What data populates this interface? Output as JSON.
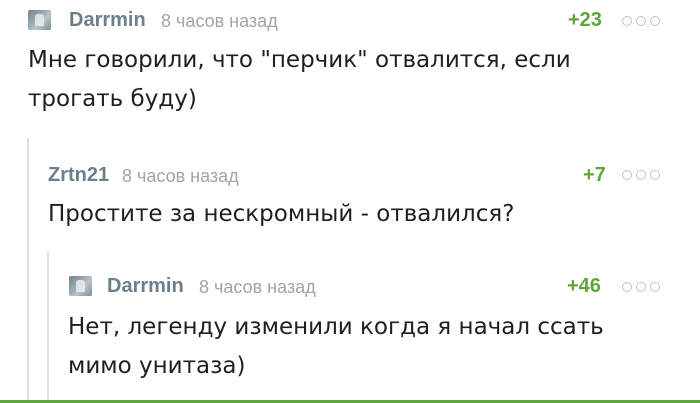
{
  "colors": {
    "rating": "#5ea53d",
    "author": "#6c7f8b",
    "time": "#9fa5a9",
    "bottom_bar": "#5ea53d"
  },
  "comments": [
    {
      "author": "Darrmin",
      "time": "8 часов назад",
      "rating": "+23",
      "has_avatar": true,
      "text_lines": [
        "Мне говорили, что \"перчик\" отвалится, если",
        "трогать буду)"
      ]
    },
    {
      "author": "Zrtn21",
      "time": "8 часов назад",
      "rating": "+7",
      "has_avatar": false,
      "text_lines": [
        "Простите за нескромный - отвалился?"
      ]
    },
    {
      "author": "Darrmin",
      "time": "8 часов назад",
      "rating": "+46",
      "has_avatar": true,
      "text_lines": [
        "Нет, легенду изменили когда я начал ссать",
        "мимо унитаза)"
      ]
    }
  ],
  "icons": {
    "more": "more-options-icon",
    "avatar": "user-avatar"
  }
}
